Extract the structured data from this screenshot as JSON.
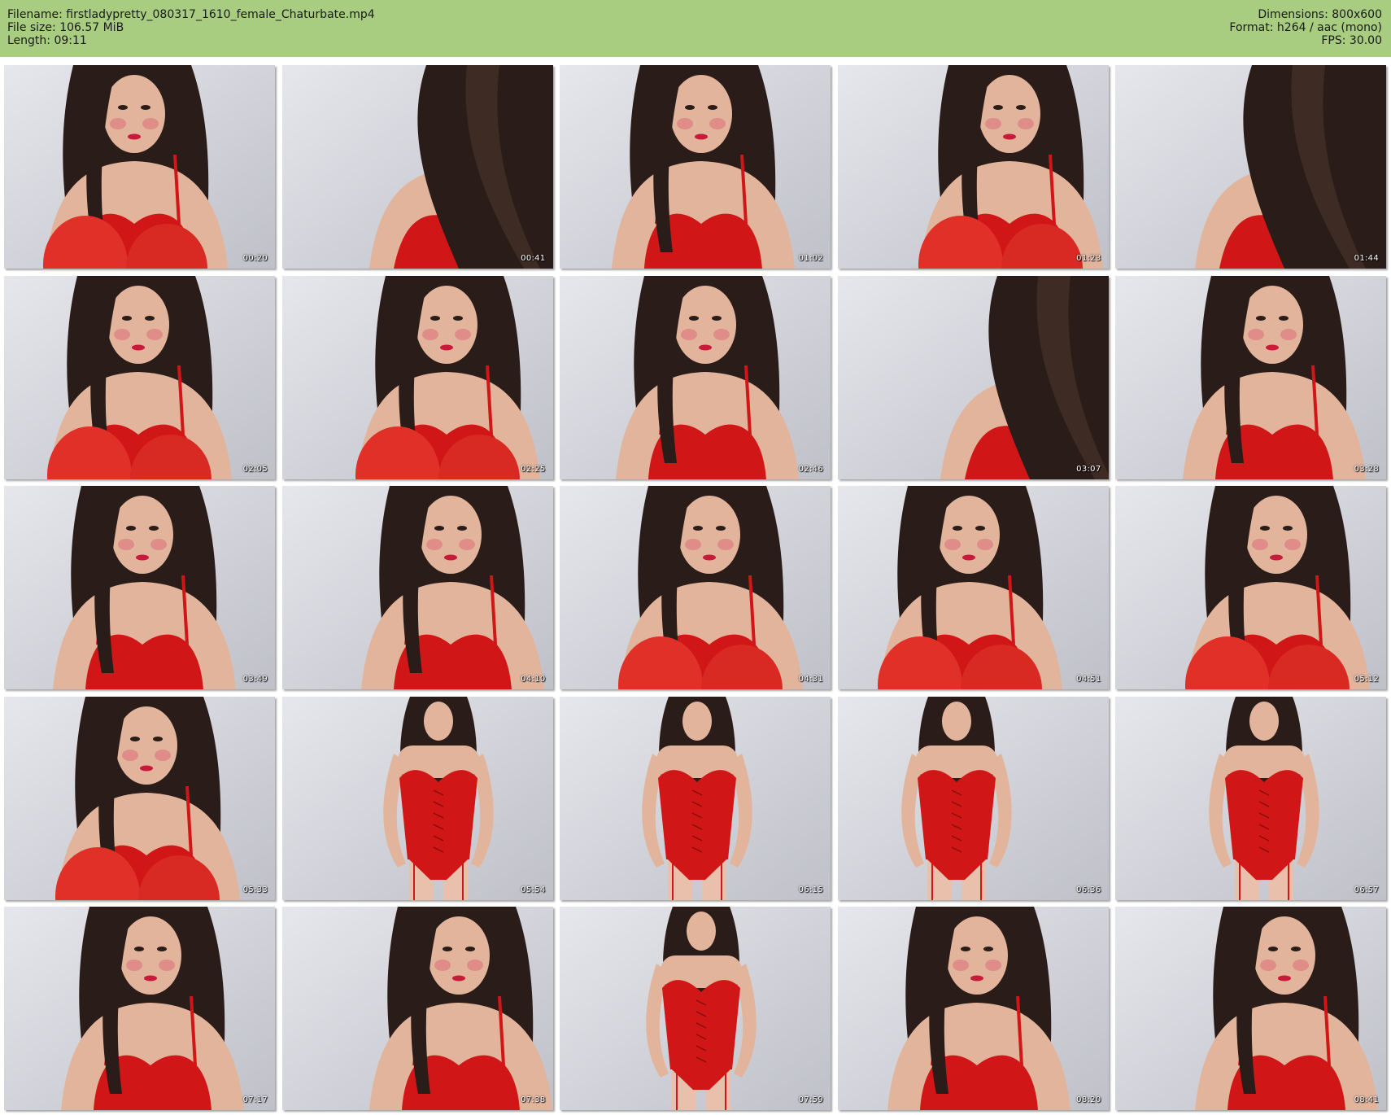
{
  "header": {
    "filename": "Filename: firstladypretty_080317_1610_female_Chaturbate.mp4",
    "filesize": "File size: 106.57 MiB",
    "length": "Length: 09:11",
    "dimensions": "Dimensions: 800x600",
    "format": "Format: h264 / aac (mono)",
    "fps": "FPS: 30.00"
  },
  "colors": {
    "header_bg": "#a8cc80",
    "wall": "#d8d9df",
    "lingerie": "#d01616",
    "hair": "#2a1c18",
    "skin": "#e2b49c"
  },
  "thumbnails": [
    {
      "time": "00:20",
      "scene": "closeup-knees"
    },
    {
      "time": "00:41",
      "scene": "hair-side"
    },
    {
      "time": "01:02",
      "scene": "closeup"
    },
    {
      "time": "01:23",
      "scene": "closeup-knees"
    },
    {
      "time": "01:44",
      "scene": "hair-side"
    },
    {
      "time": "02:05",
      "scene": "closeup-knees"
    },
    {
      "time": "02:25",
      "scene": "closeup-knees"
    },
    {
      "time": "02:46",
      "scene": "closeup"
    },
    {
      "time": "03:07",
      "scene": "hair-side"
    },
    {
      "time": "03:28",
      "scene": "closeup"
    },
    {
      "time": "03:49",
      "scene": "closeup"
    },
    {
      "time": "04:10",
      "scene": "closeup"
    },
    {
      "time": "04:31",
      "scene": "closeup-knees"
    },
    {
      "time": "04:51",
      "scene": "closeup-knees"
    },
    {
      "time": "05:12",
      "scene": "closeup-knees"
    },
    {
      "time": "05:33",
      "scene": "closeup-knees"
    },
    {
      "time": "05:54",
      "scene": "standing"
    },
    {
      "time": "06:15",
      "scene": "standing"
    },
    {
      "time": "06:36",
      "scene": "standing"
    },
    {
      "time": "06:57",
      "scene": "standing"
    },
    {
      "time": "07:17",
      "scene": "closeup"
    },
    {
      "time": "07:38",
      "scene": "closeup"
    },
    {
      "time": "07:59",
      "scene": "standing"
    },
    {
      "time": "08:20",
      "scene": "closeup"
    },
    {
      "time": "08:41",
      "scene": "closeup"
    }
  ]
}
